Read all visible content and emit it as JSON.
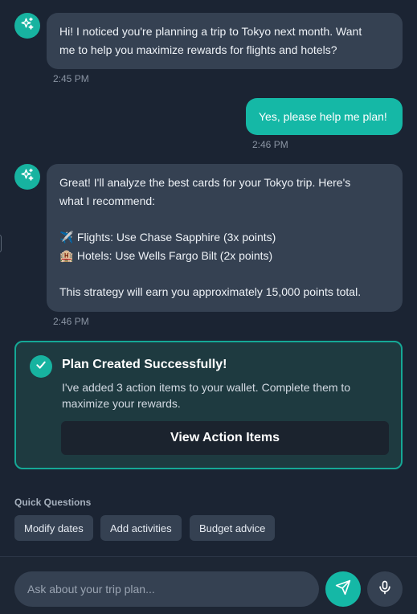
{
  "messages": [
    {
      "sender": "assistant",
      "lines": [
        "Hi! I noticed you're planning a trip to Tokyo next month. Want",
        "me to help you maximize rewards for flights and hotels?"
      ],
      "time": "2:45 PM"
    },
    {
      "sender": "user",
      "text": "Yes, please help me plan!",
      "time": "2:46 PM"
    },
    {
      "sender": "assistant",
      "lines": [
        "Great! I'll analyze the best cards for your Tokyo trip. Here's",
        "what I recommend:",
        "",
        "Flights: Use Chase Sapphire (3x points)",
        "Hotels: Use Wells Fargo Bilt (2x points)",
        "",
        "This strategy will earn you approximately 15,000 points total."
      ],
      "line_icons": [
        "",
        "",
        "",
        "✈️",
        "🏨",
        "",
        ""
      ],
      "time": "2:46 PM"
    }
  ],
  "plan_card": {
    "title": "Plan Created Successfully!",
    "description": "I've added 3 action items to your wallet. Complete them to maximize your rewards.",
    "button_label": "View Action Items"
  },
  "quick_questions": {
    "label": "Quick Questions",
    "chips": [
      "Modify dates",
      "Add activities",
      "Budget advice"
    ]
  },
  "composer": {
    "placeholder": "Ask about your trip plan..."
  },
  "colors": {
    "accent": "#15b8a6",
    "background": "#1b2433",
    "bubble": "#354152"
  },
  "icons": {
    "assistant_avatar": "sparkles-icon",
    "success": "check-icon",
    "send": "send-icon",
    "mic": "microphone-icon"
  }
}
